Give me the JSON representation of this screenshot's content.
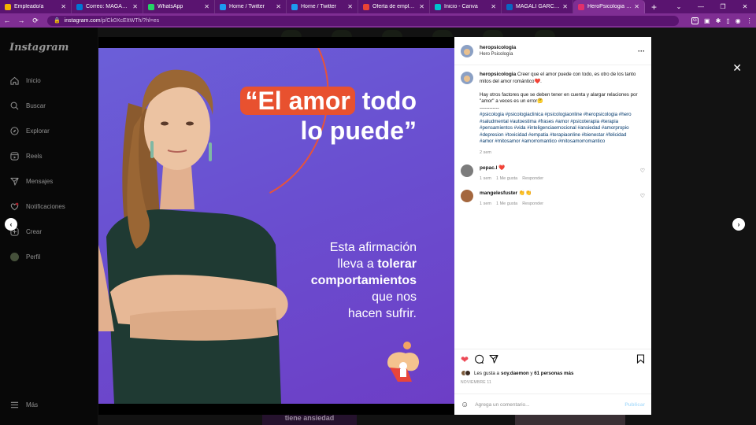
{
  "browser": {
    "tabs": [
      {
        "label": "Empleado/a",
        "color": "#f4b400"
      },
      {
        "label": "Correo: MAGALI GAR...",
        "color": "#0078d4"
      },
      {
        "label": "WhatsApp",
        "color": "#25d366"
      },
      {
        "label": "Home / Twitter",
        "color": "#1d9bf0"
      },
      {
        "label": "Home / Twitter",
        "color": "#1d9bf0"
      },
      {
        "label": "Oferta de empleo refe...",
        "color": "#ea4335"
      },
      {
        "label": "Inicio - Canva",
        "color": "#00c4cc"
      },
      {
        "label": "MAGALI GARCIA POR...",
        "color": "#0a66c2"
      },
      {
        "label": "HeroPsicologia (@her...",
        "color": "#e1306c",
        "active": true
      }
    ],
    "url_host": "instagram.com",
    "url_path": "/p/Ck0XcEItWTh/?hl=es"
  },
  "sidebar": {
    "logo": "Instagram",
    "items": [
      {
        "label": "Inicio",
        "icon": "home-icon"
      },
      {
        "label": "Buscar",
        "icon": "search-icon"
      },
      {
        "label": "Explorar",
        "icon": "compass-icon"
      },
      {
        "label": "Reels",
        "icon": "reels-icon"
      },
      {
        "label": "Mensajes",
        "icon": "send-icon"
      },
      {
        "label": "Notificaciones",
        "icon": "heart-icon"
      },
      {
        "label": "Crear",
        "icon": "plus-square-icon"
      },
      {
        "label": "Perfil",
        "icon": "avatar-icon"
      }
    ],
    "more": "Más"
  },
  "background": {
    "card1": "tiene ansiedad"
  },
  "post_image": {
    "headline_red": "“El amor",
    "headline_rest1": " todo",
    "headline_line2": "lo puede”",
    "body_l1": "Esta afirmación",
    "body_l2a": "lleva a ",
    "body_l2b": "tolerar",
    "body_l3": "comportamientos",
    "body_l4": "que nos",
    "body_l5": "hacen sufrir."
  },
  "post": {
    "username": "heropsicologia",
    "subtitle": "Hero Psicología",
    "caption_user": "heropsicologia",
    "caption_text": " Creer que el amor puede con todo, es otro de los tanto mitos del amor romántico❤️.",
    "caption_p2": "Hay otros factores que se deben tener en cuenta y alargar relaciones por \"amor\" a veces es un error🤔",
    "caption_sep": "------------",
    "hashtags": "#psicologia #psicologiaclinica #psicologiaonline #heropsicologia #hero #saludmental #autoestima #frases #amor #psicoterapia #terapia #pensamientos #vida #inteligenciaemocional #ansiedad #amorpropio #depresion #toxicidad #empatia #terapiaonline #bienestar #felicidad #amor #mitosamor #amorromantico #mitosamorromantico",
    "caption_age": "2 sem",
    "comments": [
      {
        "user": "pepac.l",
        "text": "❤️",
        "age": "1 sem",
        "likes": "1 Me gusta",
        "reply": "Responder"
      },
      {
        "user": "mangelesfuster",
        "text": "👏👏",
        "age": "1 sem",
        "likes": "1 Me gusta",
        "reply": "Responder"
      }
    ],
    "likes_prefix": "Les gusta a ",
    "likes_user": "soy.daemon",
    "likes_middle": " y ",
    "likes_count": "61 personas más",
    "date": "NOVIEMBRE 11",
    "comment_placeholder": "Agrega un comentario...",
    "publish": "Publicar"
  },
  "colors": {
    "accent_red": "#e8512f",
    "tab_bar": "#5a1470",
    "like_red": "#ed4956"
  }
}
